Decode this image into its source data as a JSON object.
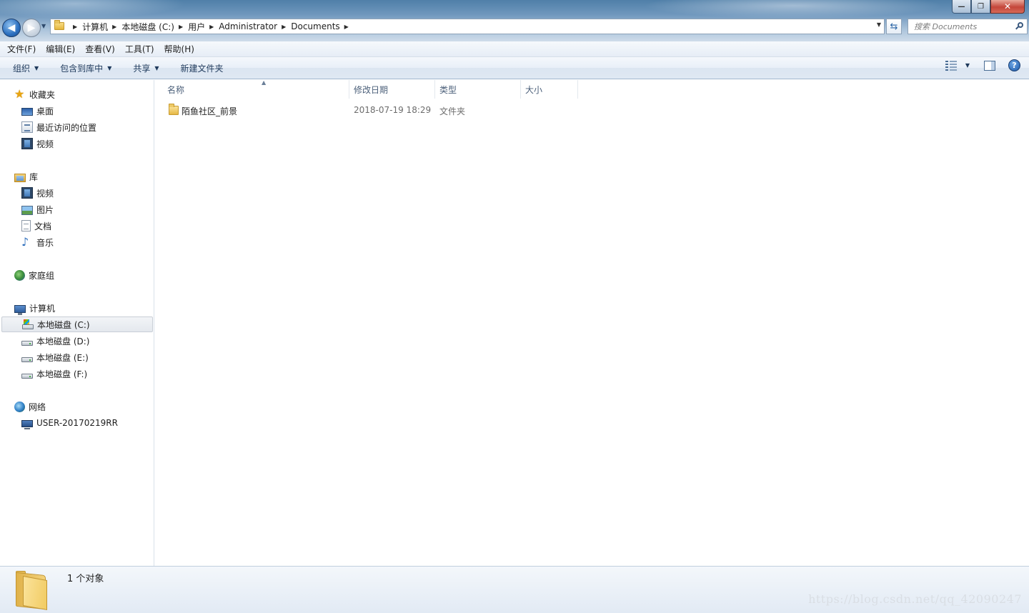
{
  "window": {
    "minimize_glyph": "—",
    "maximize_glyph": "❐",
    "close_glyph": "✕"
  },
  "address": {
    "crumbs": [
      "计算机",
      "本地磁盘 (C:)",
      "用户",
      "Administrator",
      "Documents"
    ]
  },
  "search": {
    "placeholder": "搜索 Documents"
  },
  "menu": [
    "文件(F)",
    "编辑(E)",
    "查看(V)",
    "工具(T)",
    "帮助(H)"
  ],
  "toolbar": {
    "organize": "组织",
    "include_library": "包含到库中",
    "share": "共享",
    "new_folder": "新建文件夹"
  },
  "sidebar": {
    "favorites": {
      "label": "收藏夹",
      "items": [
        "桌面",
        "最近访问的位置",
        "视频"
      ]
    },
    "libraries": {
      "label": "库",
      "items": [
        "视频",
        "图片",
        "文档",
        "音乐"
      ]
    },
    "homegroup": {
      "label": "家庭组"
    },
    "computer": {
      "label": "计算机",
      "items": [
        "本地磁盘 (C:)",
        "本地磁盘 (D:)",
        "本地磁盘 (E:)",
        "本地磁盘 (F:)"
      ]
    },
    "network": {
      "label": "网络",
      "items": [
        "USER-20170219RR"
      ]
    }
  },
  "columns": {
    "name": "名称",
    "modified": "修改日期",
    "type": "类型",
    "size": "大小"
  },
  "files": [
    {
      "name": "陌鱼社区_前景",
      "modified": "2018-07-19 18:29",
      "type": "文件夹",
      "size": ""
    }
  ],
  "status": {
    "count": "1 个对象"
  },
  "watermark": "https://blog.csdn.net/qq_42090247",
  "colors": {
    "accent": "#1e395b",
    "title_gradient_top": "#4f7fa8",
    "close_button": "#c4463a"
  }
}
